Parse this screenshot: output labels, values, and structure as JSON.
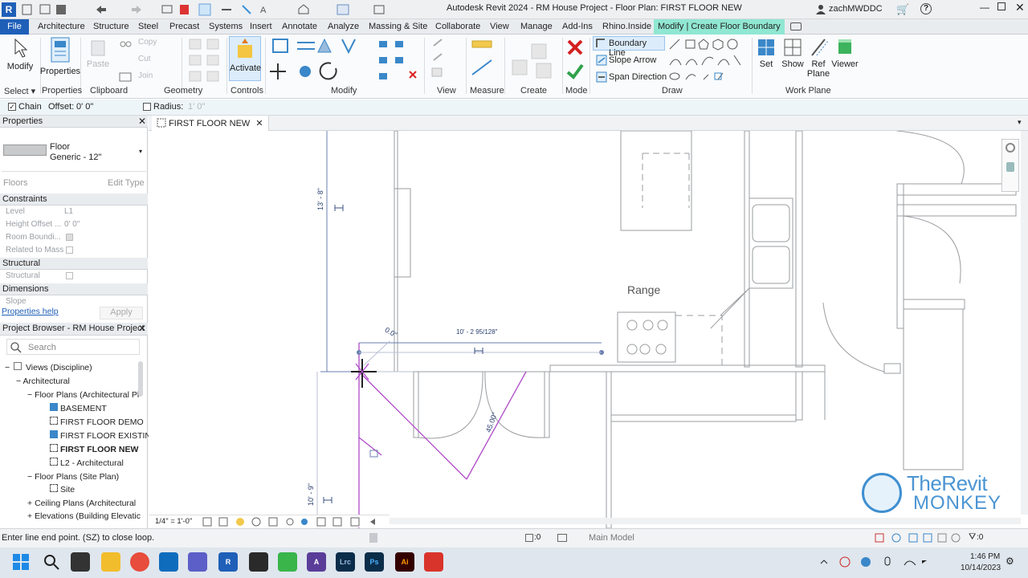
{
  "title_bar": {
    "app_title": "Autodesk Revit 2024 - RM House Project - Floor Plan: FIRST FLOOR NEW",
    "user": "zachMWDDC",
    "app_badge": "R"
  },
  "ribbon_tabs": [
    "File",
    "Architecture",
    "Structure",
    "Steel",
    "Precast",
    "Systems",
    "Insert",
    "Annotate",
    "Analyze",
    "Massing & Site",
    "Collaborate",
    "View",
    "Manage",
    "Add-Ins",
    "Rhino.Inside",
    "Modify | Create Floor Boundary"
  ],
  "ribbon": {
    "modify": "Modify",
    "properties": "Properties",
    "copy": "Copy",
    "cut": "Cut",
    "paste": "Paste",
    "join": "Join",
    "activate": "Activate",
    "boundary_line": "Boundary Line",
    "slope_arrow": "Slope Arrow",
    "span_direction": "Span Direction",
    "set": "Set",
    "show": "Show",
    "ref_plane": "Ref Plane",
    "viewer": "Viewer",
    "panels": {
      "select": "Select",
      "properties": "Properties",
      "clipboard": "Clipboard",
      "geometry": "Geometry",
      "controls": "Controls",
      "modify": "Modify",
      "view": "View",
      "measure": "Measure",
      "create": "Create",
      "mode": "Mode",
      "draw": "Draw",
      "work_plane": "Work Plane"
    }
  },
  "options_bar": {
    "chain_label": "Chain",
    "offset_label": "Offset:",
    "offset_value": "0'  0\"",
    "radius_label": "Radius:",
    "radius_value": "1'  0\""
  },
  "properties_panel": {
    "header": "Properties",
    "type_name": "Floor",
    "type_sub": "Generic - 12\"",
    "category": "Floors",
    "edit_type": "Edit Type",
    "sections": [
      {
        "name": "Constraints"
      },
      {
        "name": "Structural"
      },
      {
        "name": "Dimensions"
      }
    ],
    "rows": [
      {
        "label": "Level",
        "value": "L1"
      },
      {
        "label": "Height Offset ...",
        "value": "0'  0\""
      },
      {
        "label": "Room Boundi...",
        "value": ""
      },
      {
        "label": "Related to Mass",
        "value": ""
      },
      {
        "label": "Structural",
        "value": ""
      },
      {
        "label": "Slope",
        "value": ""
      }
    ],
    "help_link": "Properties help",
    "apply": "Apply"
  },
  "project_browser": {
    "header": "Project Browser - RM House Project",
    "search_placeholder": "Search",
    "items": [
      "Views (Discipline)",
      "Architectural",
      "Floor Plans (Architectural Pl",
      "BASEMENT",
      "FIRST FLOOR DEMO",
      "FIRST FLOOR EXISTIN",
      "FIRST FLOOR NEW",
      "L2 - Architectural",
      "Floor Plans (Site Plan)",
      "Site",
      "Ceiling Plans (Architectural",
      "Elevations (Building Elevatic"
    ]
  },
  "view": {
    "tab_name": "FIRST FLOOR NEW",
    "room_label": "Range",
    "dim_top": "13' - 8\"",
    "dim_bottom": "10' - 9\"",
    "dim_horizontal": "10' - 2 95/128\"",
    "dim_zero": "0.0\"",
    "angle_label": "45.00°",
    "scale": "1/4\" = 1'-0\""
  },
  "watermark": {
    "line1": "TheRevit",
    "line2": "MONKEY"
  },
  "status_bar": {
    "message": "Enter line end point. (SZ) to close loop.",
    "model": "Main Model",
    "sel_count": ":0",
    "filter_count": ":0"
  },
  "taskbar": {
    "time": "1:46 PM",
    "date": "10/14/2023"
  }
}
